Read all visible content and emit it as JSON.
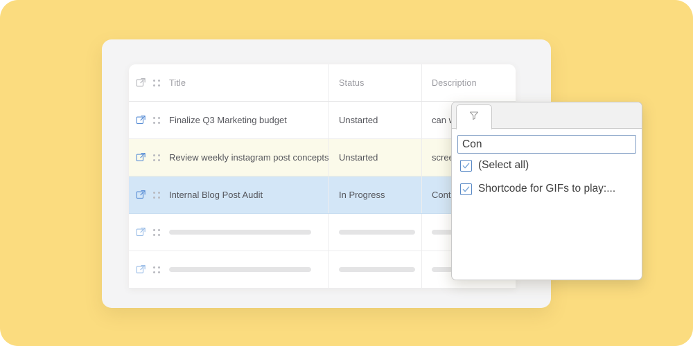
{
  "colors": {
    "background": "#fbdc7f",
    "app_card": "#f4f4f5",
    "table_panel": "#ffffff",
    "row_highlight_yellow": "#fbfaea",
    "row_highlight_blue": "#d3e6f7",
    "accent_blue": "#5a8ac6",
    "link_icon_blue": "#5b8fd6",
    "header_text": "#9b9ba1",
    "cell_text": "#55565c",
    "placeholder_bar": "#e4e4e5"
  },
  "table": {
    "columns": [
      {
        "key": "title",
        "label": "Title"
      },
      {
        "key": "status",
        "label": "Status"
      },
      {
        "key": "description",
        "label": "Description"
      }
    ],
    "header_icons": {
      "open_icon": "external-link-icon",
      "drag_icon": "drag-dots-icon"
    },
    "rows": [
      {
        "title": "Finalize Q3 Marketing budget",
        "status": "Unstarted",
        "description": "can w",
        "highlight": "none",
        "placeholder": false
      },
      {
        "title": "Review weekly instagram post concepts",
        "status": "Unstarted",
        "description": "screen",
        "highlight": "yellow",
        "placeholder": false
      },
      {
        "title": "Internal Blog Post Audit",
        "status": "In Progress",
        "description": "Contin",
        "highlight": "blue",
        "placeholder": false
      },
      {
        "title": "",
        "status": "",
        "description": "",
        "highlight": "none",
        "placeholder": true
      },
      {
        "title": "",
        "status": "",
        "description": "",
        "highlight": "none",
        "placeholder": true
      }
    ]
  },
  "filter_popup": {
    "tab": {
      "name": "filter-tab",
      "icon": "funnel-icon"
    },
    "search": {
      "value": "Con",
      "placeholder": ""
    },
    "options": [
      {
        "label": "(Select all)",
        "checked": true
      },
      {
        "label": "Shortcode for GIFs to play:...",
        "checked": true
      }
    ]
  }
}
